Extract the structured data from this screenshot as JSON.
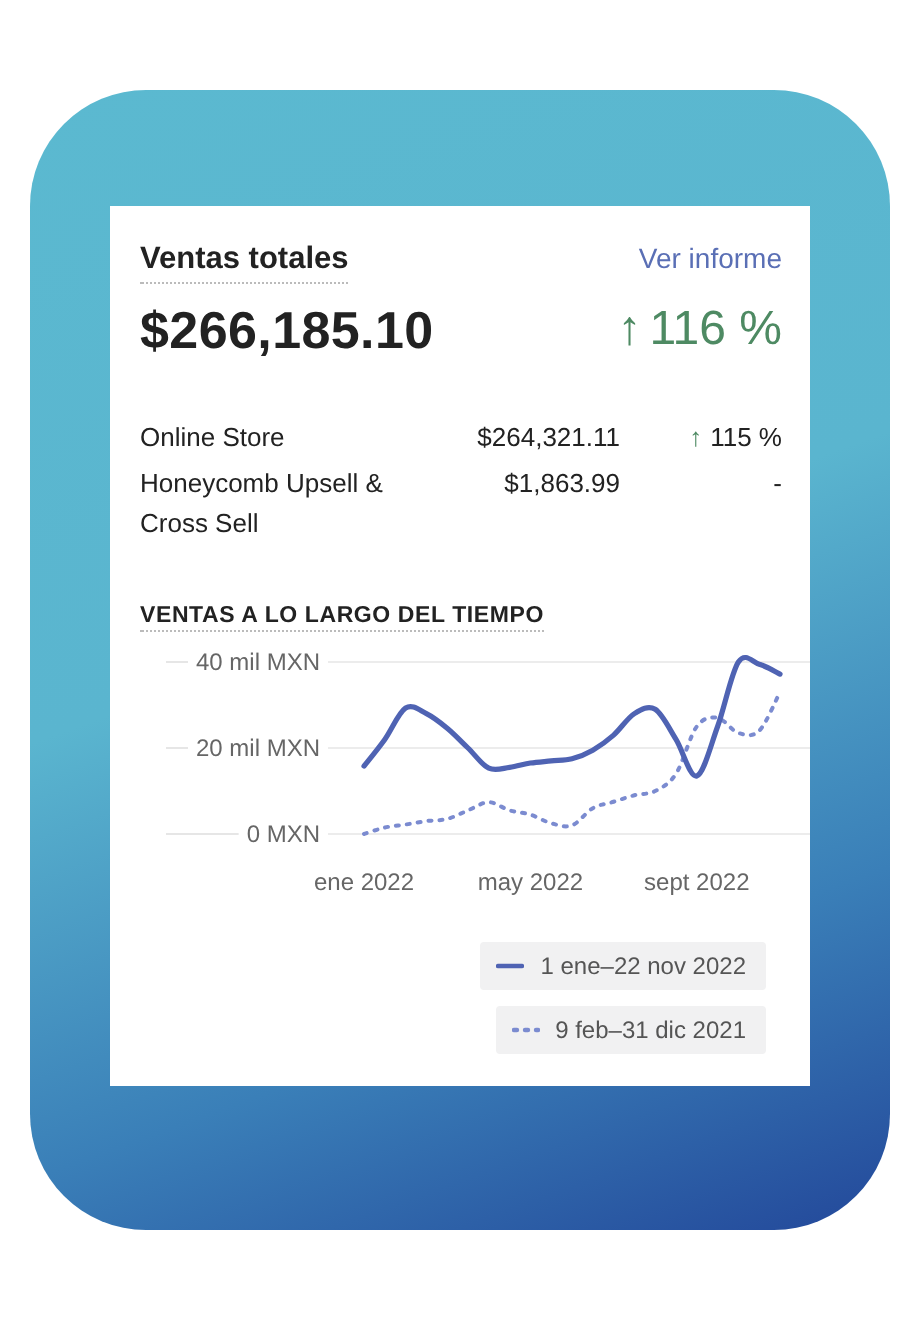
{
  "summary": {
    "title": "Ventas totales",
    "link": "Ver informe",
    "total": "$266,185.10",
    "change": {
      "arrow": "↑",
      "text": "116 %"
    }
  },
  "channels": [
    {
      "name": "Online Store",
      "amount": "$264,321.11",
      "arrow": "↑",
      "change": "115 %"
    },
    {
      "name": "Honeycomb Upsell & Cross Sell",
      "amount": "$1,863.99",
      "change": "-"
    }
  ],
  "over_time": {
    "title": "VENTAS A LO LARGO DEL TIEMPO",
    "chart_data": {
      "type": "line",
      "categories": [
        "ene 2022",
        null,
        null,
        null,
        null,
        null,
        null,
        null,
        "may 2022",
        null,
        null,
        null,
        null,
        null,
        null,
        null,
        "sept 2022",
        null,
        null,
        null,
        null
      ],
      "series": [
        {
          "name": "1 ene–22 nov 2022",
          "color": "#4f63b3",
          "line_style": "solid",
          "values": [
            15.8,
            22,
            29.3,
            28,
            24.6,
            20,
            15.3,
            15.5,
            16.5,
            17,
            17.5,
            19.5,
            23,
            28,
            29,
            22,
            13.5,
            25,
            40,
            39.5,
            37.2
          ]
        },
        {
          "name": "9 feb–31 dic 2021",
          "color": "#7b8bd0",
          "line_style": "dotted",
          "values": [
            0,
            1.5,
            2.2,
            3,
            3.5,
            5.5,
            7.4,
            5.5,
            4.5,
            2.5,
            2,
            6,
            7.5,
            9,
            10,
            14,
            25,
            27,
            23.5,
            24,
            33
          ]
        }
      ],
      "ylim": [
        0,
        40
      ],
      "yticks": [
        {
          "value": 0,
          "label": "0 MXN"
        },
        {
          "value": 20,
          "label": "20 mil MXN"
        },
        {
          "value": 40,
          "label": "40 mil MXN"
        }
      ]
    }
  }
}
